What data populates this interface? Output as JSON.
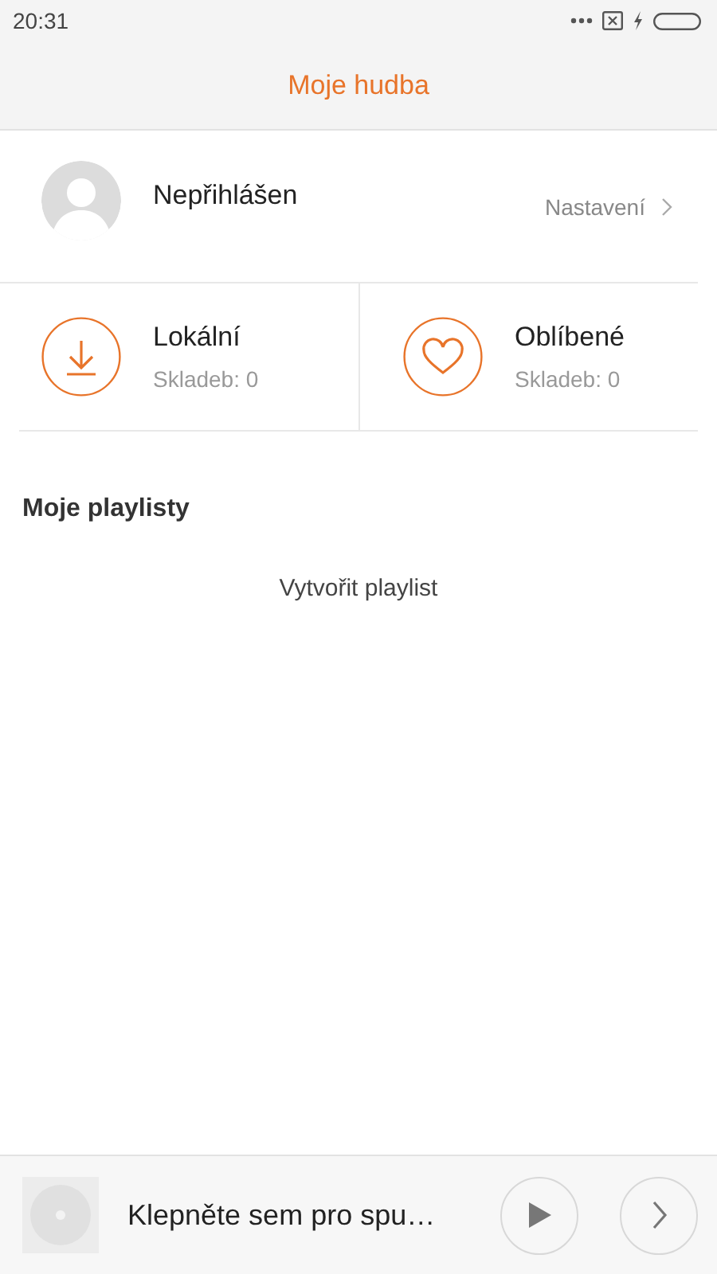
{
  "status_bar": {
    "time": "20:31"
  },
  "header": {
    "title": "Moje hudba"
  },
  "profile": {
    "name": "Nepřihlášen",
    "settings_link": "Nastavení"
  },
  "collections": [
    {
      "kind": "download",
      "title": "Lokální",
      "count": "Skladeb: 0"
    },
    {
      "kind": "heart",
      "title": "Oblíbené",
      "count": "Skladeb: 0"
    }
  ],
  "playlists": {
    "heading": "Moje playlisty",
    "create_label": "Vytvořit playlist"
  },
  "player": {
    "prompt": "Klepněte sem pro spu…"
  }
}
